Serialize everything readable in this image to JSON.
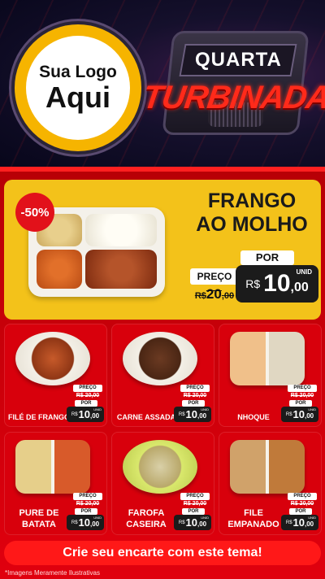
{
  "header": {
    "logo_line1": "Sua Logo",
    "logo_line2": "Aqui",
    "badge_top": "QUARTA",
    "badge_main": "TURBINADA"
  },
  "feature": {
    "discount": "-50%",
    "title_line1": "FRANGO",
    "title_line2": "AO MOLHO",
    "por": "POR",
    "preco": "PREÇO",
    "old_currency": "R$",
    "old_int": "20",
    "old_cent": ",00",
    "currency": "R$",
    "int": "10",
    "cent": ",00",
    "unid": "UNID"
  },
  "cards": [
    {
      "name": "FILÉ DE FRANGO",
      "preco": "PREÇO",
      "old": "R$ 20,00",
      "por": "POR",
      "currency": "R$",
      "int": "10",
      "cent": ",00",
      "unid": "UNID"
    },
    {
      "name": "CARNE ASSADA",
      "preco": "PREÇO",
      "old": "R$ 20,00",
      "por": "POR",
      "currency": "R$",
      "int": "10",
      "cent": ",00",
      "unid": "UNID"
    },
    {
      "name": "NHOQUE",
      "preco": "PREÇO",
      "old": "R$ 20,00",
      "por": "POR",
      "currency": "R$",
      "int": "10",
      "cent": ",00",
      "unid": "UNID"
    },
    {
      "name": "PURE DE BATATA",
      "preco": "PREÇO",
      "old": "R$ 20,00",
      "por": "POR",
      "currency": "R$",
      "int": "10",
      "cent": ",00",
      "unid": "UNID"
    },
    {
      "name": "FAROFA CASEIRA",
      "preco": "PREÇO",
      "old": "R$ 20,00",
      "por": "POR",
      "currency": "R$",
      "int": "10",
      "cent": ",00",
      "unid": "UNID"
    },
    {
      "name": "FILE EMPANADO",
      "preco": "PREÇO",
      "old": "R$ 20,00",
      "por": "POR",
      "currency": "R$",
      "int": "10",
      "cent": ",00",
      "unid": "UNID"
    }
  ],
  "cta": "Crie seu encarte com este tema!",
  "footnote": "*Imagens Meramente Ilustrativas"
}
